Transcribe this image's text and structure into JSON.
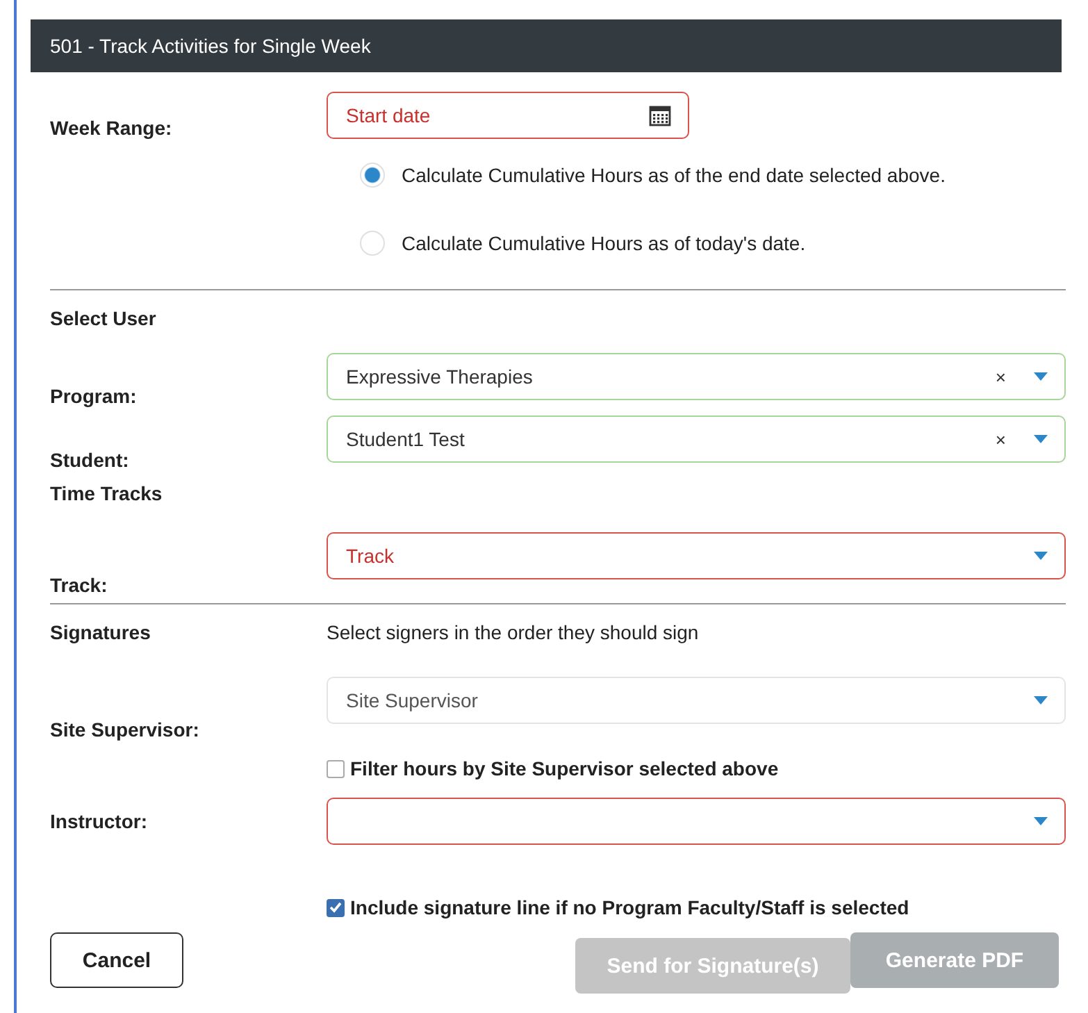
{
  "dialog": {
    "title": "501 - Track Activities for Single Week"
  },
  "week_range": {
    "label": "Week Range:",
    "field": {
      "placeholder": "Start date",
      "invalid": true,
      "valid": false
    },
    "radios": [
      {
        "label": "Calculate Cumulative Hours as of the end date selected above.",
        "selected": true
      },
      {
        "label": "Calculate Cumulative Hours as of today's date.",
        "selected": false
      }
    ]
  },
  "select_user": {
    "heading": "Select User",
    "program": {
      "label": "Program:",
      "value": "Expressive Therapies",
      "invalid": false,
      "valid": true,
      "clear": "×"
    },
    "student": {
      "label": "Student:",
      "value": "Student1 Test",
      "invalid": false,
      "valid": true,
      "clear": "×"
    }
  },
  "time_tracks": {
    "heading": "Time Tracks",
    "track": {
      "label": "Track:",
      "placeholder": "Track",
      "invalid": true,
      "valid": false
    }
  },
  "signatures": {
    "heading": "Signatures",
    "hint": "Select signers in the order they should sign",
    "site_supervisor": {
      "label": "Site Supervisor:",
      "placeholder": "Site Supervisor",
      "invalid": false,
      "valid": false
    },
    "filter": {
      "label": "Filter hours by Site Supervisor selected above",
      "checked": false
    },
    "instructor": {
      "label": "Instructor:",
      "invalid": true,
      "valid": false
    },
    "include_line": {
      "label": "Include signature line if no Program Faculty/Staff is selected",
      "checked": true
    }
  },
  "buttons": [
    {
      "label": "Cancel",
      "kind": "cancel",
      "disabled": false
    },
    {
      "label": "Send for Signature(s)",
      "kind": "send",
      "disabled": true
    },
    {
      "label": "Generate PDF",
      "kind": "pdf",
      "disabled": true
    }
  ]
}
